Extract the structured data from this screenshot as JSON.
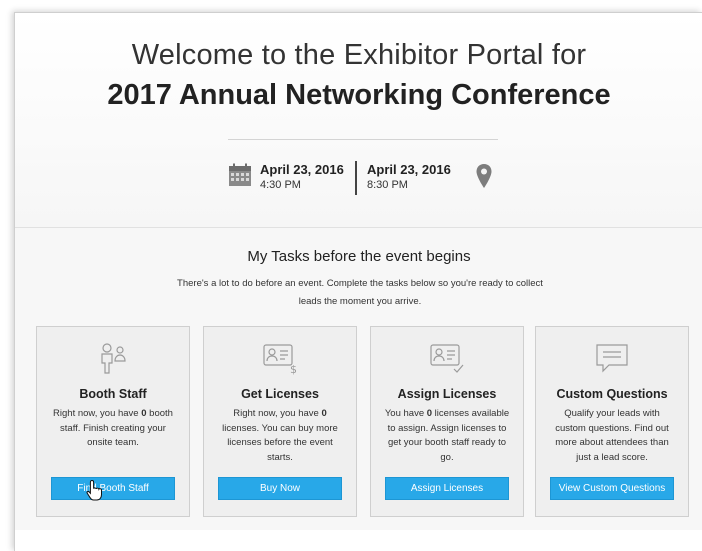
{
  "header": {
    "title_line1": "Welcome to the Exhibitor Portal for",
    "title_line2": "2017 Annual Networking Conference",
    "start": {
      "date": "April 23, 2016",
      "time": "4:30 PM"
    },
    "end": {
      "date": "April 23, 2016",
      "time": "8:30 PM"
    },
    "icons": {
      "calendar": "calendar-icon",
      "location": "map-pin-icon"
    }
  },
  "tasks": {
    "title": "My Tasks before the event begins",
    "subtitle": "There's a lot to do before an event. Complete the tasks below so you're ready to collect leads the moment you arrive."
  },
  "cards": [
    {
      "icon": "people-icon",
      "title": "Booth Staff",
      "text_before": "Right now, you have ",
      "count": "0",
      "text_after": " booth staff. Finish creating your onsite team.",
      "button": "Find Booth Staff"
    },
    {
      "icon": "license-dollar-icon",
      "title": "Get Licenses",
      "text_before": "Right now, you have ",
      "count": "0",
      "text_after": " licenses. You can buy more licenses before the event starts.",
      "button": "Buy Now"
    },
    {
      "icon": "license-check-icon",
      "title": "Assign Licenses",
      "text_before": "You have ",
      "count": "0",
      "text_after": " licenses available to assign. Assign licenses to get your booth staff ready to go.",
      "button": "Assign Licenses"
    },
    {
      "icon": "chat-icon",
      "title": "Custom Questions",
      "text_before": "Qualify your leads with custom questions. Find out more about attendees than just a lead score.",
      "count": "",
      "text_after": "",
      "button": "View Custom Questions"
    }
  ],
  "colors": {
    "button": "#28a8e8",
    "card_bg": "#efefef",
    "page_bg": "#f7f7f7"
  }
}
